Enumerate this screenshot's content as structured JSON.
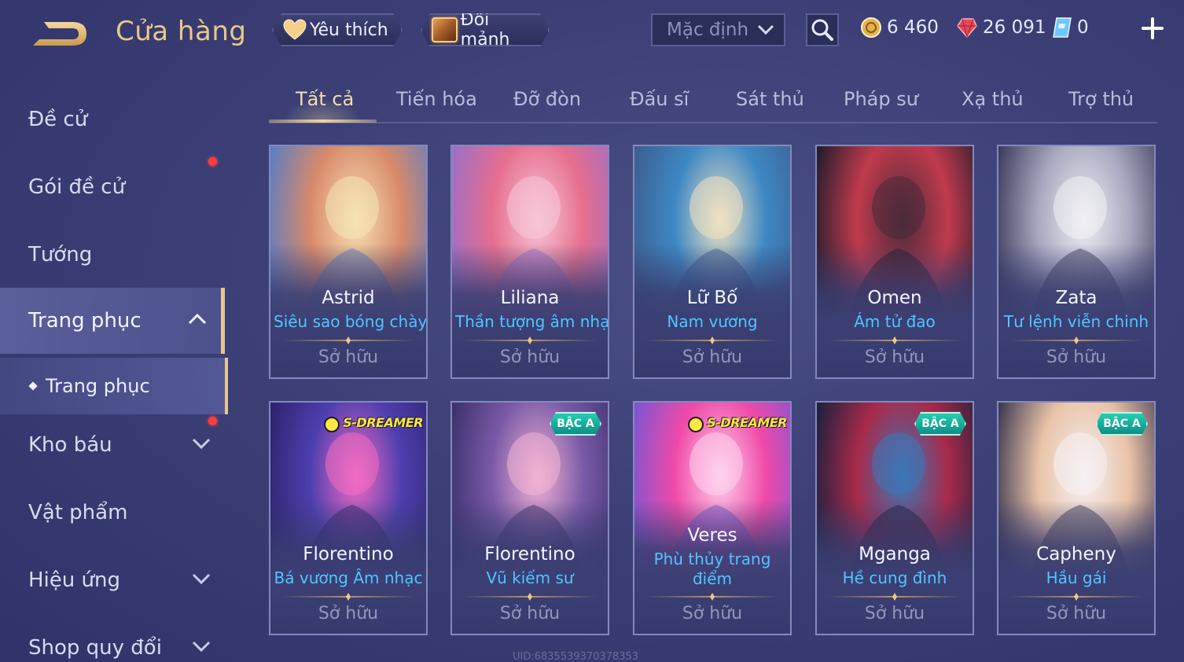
{
  "header": {
    "title": "Cửa hàng",
    "favorites_label": "Yêu thích",
    "exchange_label": "Đổi mảnh",
    "sort_value": "Mặc định",
    "currencies": [
      {
        "name": "gold-coin",
        "value": "6 460",
        "color": "#e6b24c"
      },
      {
        "name": "ruby",
        "value": "26 091",
        "color": "#e4495a"
      },
      {
        "name": "voucher",
        "value": "0",
        "color": "#6fc7ff"
      }
    ]
  },
  "sidebar": {
    "items": [
      {
        "label": "Đề cử"
      },
      {
        "label": "Gói đề cử",
        "notification": true
      },
      {
        "label": "Tướng"
      },
      {
        "label": "Trang phục",
        "expanded": true,
        "active": true
      },
      {
        "label": "Kho báu",
        "notification": true,
        "expandable": true
      },
      {
        "label": "Vật phẩm"
      },
      {
        "label": "Hiệu ứng",
        "expandable": true
      },
      {
        "label": "Shop quy đổi",
        "expandable": true
      }
    ],
    "subitem": "Trang phục"
  },
  "tabs": [
    "Tất cả",
    "Tiến hóa",
    "Đỡ đòn",
    "Đấu sĩ",
    "Sát thủ",
    "Pháp sư",
    "Xạ thủ",
    "Trợ thủ"
  ],
  "active_tab": "Tất cả",
  "owned_label": "Sở hữu",
  "cards": [
    {
      "hero": "Astrid",
      "skin": "Siêu sao bóng chày",
      "status": "Sở hữu",
      "badge": "",
      "palette": [
        "#f6e3b5",
        "#d98a6a",
        "#5b7cc4"
      ]
    },
    {
      "hero": "Liliana",
      "skin": "Thần tượng âm nhạc",
      "status": "Sở hữu",
      "badge": "",
      "palette": [
        "#f7c6d8",
        "#e66e8e",
        "#9a6fc9"
      ]
    },
    {
      "hero": "Lữ Bố",
      "skin": "Nam vương",
      "status": "Sở hữu",
      "badge": "",
      "palette": [
        "#f1e2c2",
        "#3e88c4",
        "#3c5d8e"
      ]
    },
    {
      "hero": "Omen",
      "skin": "Ám tử đao",
      "status": "Sở hữu",
      "badge": "",
      "palette": [
        "#4a2a3a",
        "#c13a4d",
        "#1e1c2c"
      ]
    },
    {
      "hero": "Zata",
      "skin": "Tư lệnh viễn chinh",
      "status": "Sở hữu",
      "badge": "",
      "palette": [
        "#f0f0f4",
        "#a8a8c0",
        "#3b3a5c"
      ]
    },
    {
      "hero": "Florentino",
      "skin": "Bá vương Âm nhạc",
      "status": "Sở hữu",
      "badge": "S-DREAMER",
      "palette": [
        "#f36bc2",
        "#4e3fb0",
        "#2d236b"
      ]
    },
    {
      "hero": "Florentino",
      "skin": "Vũ kiếm sư",
      "status": "Sở hữu",
      "badge": "BẬC A",
      "palette": [
        "#f2b2d4",
        "#7a5aa8",
        "#3b2f6a"
      ]
    },
    {
      "hero": "Veres",
      "skin": "Phù thủy trang điểm",
      "status": "Sở hữu",
      "badge": "S-DREAMER",
      "palette": [
        "#ffd2ee",
        "#f04aa8",
        "#7a55d4"
      ]
    },
    {
      "hero": "Mganga",
      "skin": "Hề cung đình",
      "status": "Sở hữu",
      "badge": "BẬC A",
      "palette": [
        "#3c77b8",
        "#a82a4a",
        "#1a1f3e"
      ]
    },
    {
      "hero": "Capheny",
      "skin": "Hầu gái",
      "status": "Sở hữu",
      "badge": "BẬC A",
      "palette": [
        "#f6f1f4",
        "#e9c3a8",
        "#3a3650"
      ]
    }
  ],
  "watermark": "UID:68355393703783­53",
  "colors": {
    "accent_gold": "#e7c78b",
    "skin_text": "#4fc6ff",
    "notification": "#ff3b3b"
  }
}
